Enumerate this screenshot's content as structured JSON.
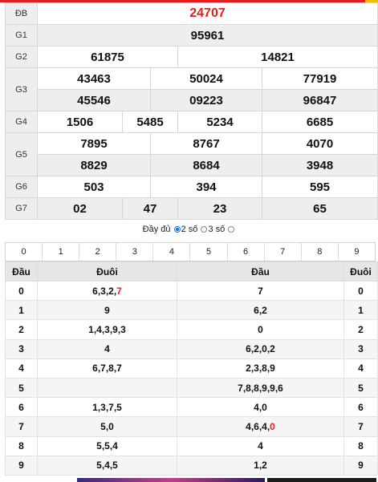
{
  "results": {
    "db_label": "ĐB",
    "db": "24707",
    "g1_label": "G1",
    "g1": "95961",
    "g2_label": "G2",
    "g2": [
      "61875",
      "14821"
    ],
    "g3_label": "G3",
    "g3": [
      "43463",
      "50024",
      "77919",
      "45546",
      "09223",
      "96847"
    ],
    "g4_label": "G4",
    "g4": [
      "1506",
      "5485",
      "5234",
      "6685"
    ],
    "g5_label": "G5",
    "g5": [
      "7895",
      "8767",
      "4070",
      "8829",
      "8684",
      "3948"
    ],
    "g6_label": "G6",
    "g6": [
      "503",
      "394",
      "595"
    ],
    "g7_label": "G7",
    "g7": [
      "02",
      "47",
      "23",
      "65"
    ]
  },
  "options": {
    "full_label": "Đầy đủ",
    "two_label": "2 số",
    "three_label": "3 số",
    "selected": "2 số"
  },
  "digit_filter": [
    "0",
    "1",
    "2",
    "3",
    "4",
    "5",
    "6",
    "7",
    "8",
    "9"
  ],
  "loto": {
    "headers": [
      "Đầu",
      "Đuôi",
      "Đầu",
      "Đuôi"
    ],
    "rows": [
      {
        "dau": "0",
        "duoi": "6,3,2,",
        "duoi_hl": "7",
        "dau2": "7",
        "dau2_hl": "",
        "duoi2": "0"
      },
      {
        "dau": "1",
        "duoi": "9",
        "duoi_hl": "",
        "dau2": "6,2",
        "dau2_hl": "",
        "duoi2": "1"
      },
      {
        "dau": "2",
        "duoi": "1,4,3,9,3",
        "duoi_hl": "",
        "dau2": "0",
        "dau2_hl": "",
        "duoi2": "2"
      },
      {
        "dau": "3",
        "duoi": "4",
        "duoi_hl": "",
        "dau2": "6,2,0,2",
        "dau2_hl": "",
        "duoi2": "3"
      },
      {
        "dau": "4",
        "duoi": "6,7,8,7",
        "duoi_hl": "",
        "dau2": "2,3,8,9",
        "dau2_hl": "",
        "duoi2": "4"
      },
      {
        "dau": "5",
        "duoi": "",
        "duoi_hl": "",
        "dau2": "7,8,8,9,9,6",
        "dau2_hl": "",
        "duoi2": "5"
      },
      {
        "dau": "6",
        "duoi": "1,3,7,5",
        "duoi_hl": "",
        "dau2": "4,0",
        "dau2_hl": "",
        "duoi2": "6"
      },
      {
        "dau": "7",
        "duoi": "5,0",
        "duoi_hl": "",
        "dau2": "4,6,4,",
        "dau2_hl": "0",
        "duoi2": "7"
      },
      {
        "dau": "8",
        "duoi": "5,5,4",
        "duoi_hl": "",
        "dau2": "4",
        "dau2_hl": "",
        "duoi2": "8"
      },
      {
        "dau": "9",
        "duoi": "5,4,5",
        "duoi_hl": "",
        "dau2": "1,2",
        "dau2_hl": "",
        "duoi2": "9"
      }
    ]
  },
  "colors": {
    "accent_red": "#e02020",
    "accent_yellow": "#f0c000",
    "radio_blue": "#1a73e8"
  }
}
